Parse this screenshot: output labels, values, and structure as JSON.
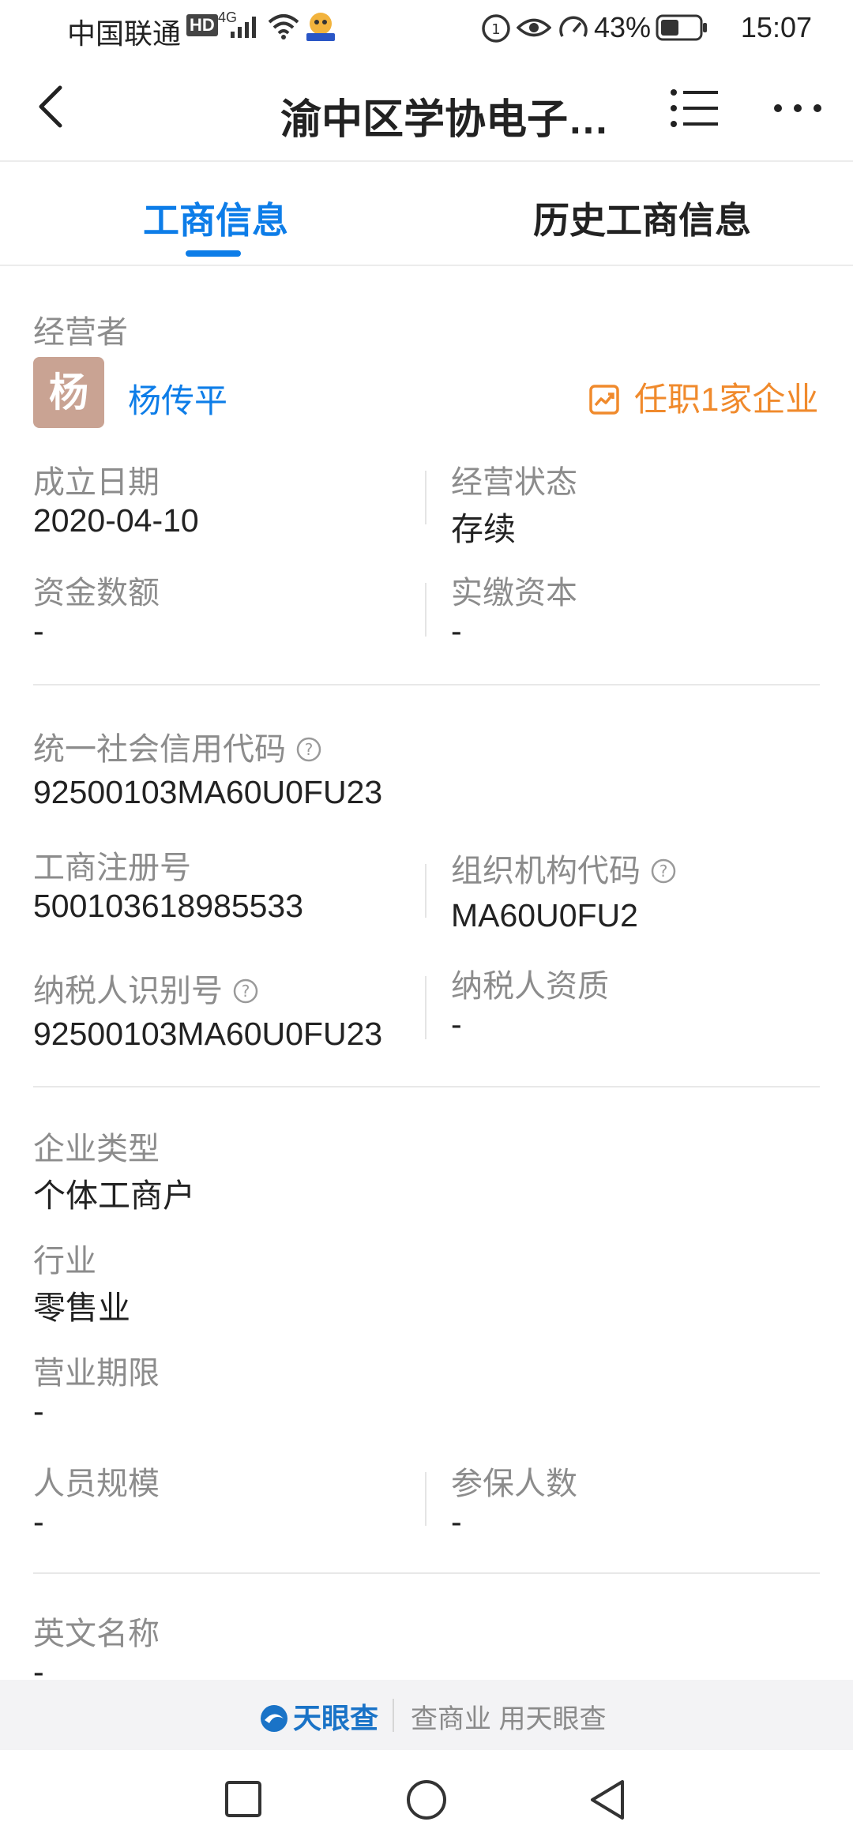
{
  "status_bar": {
    "carrier": "中国联通",
    "net_badge": "HD",
    "net_gen": "4G",
    "battery_percent": "43%",
    "time": "15:07"
  },
  "nav": {
    "title": "渝中区学协电子…"
  },
  "tabs": [
    {
      "label": "工商信息",
      "active": true
    },
    {
      "label": "历史工商信息",
      "active": false
    }
  ],
  "operator": {
    "label": "经营者",
    "avatar_char": "杨",
    "name": "杨传平",
    "jobs": "任职1家企业"
  },
  "info": {
    "established_label": "成立日期",
    "established_value": "2020-04-10",
    "status_label": "经营状态",
    "status_value": "存续",
    "capital_label": "资金数额",
    "capital_value": "-",
    "paid_label": "实缴资本",
    "paid_value": "-",
    "credit_label": "统一社会信用代码",
    "credit_value": "92500103MA60U0FU23",
    "reg_label": "工商注册号",
    "reg_value": "500103618985533",
    "org_label": "组织机构代码",
    "org_value": "MA60U0FU2",
    "taxid_label": "纳税人识别号",
    "taxid_value": "92500103MA60U0FU23",
    "taxqual_label": "纳税人资质",
    "taxqual_value": "-",
    "type_label": "企业类型",
    "type_value": "个体工商户",
    "industry_label": "行业",
    "industry_value": "零售业",
    "term_label": "营业期限",
    "term_value": "-",
    "staff_label": "人员规模",
    "staff_value": "-",
    "insured_label": "参保人数",
    "insured_value": "-",
    "english_label": "英文名称",
    "english_value": "-"
  },
  "footer": {
    "brand": "天眼查",
    "slogan": "查商业 用天眼查"
  },
  "colors": {
    "accent": "#0d7de8",
    "orange": "#f08a2c",
    "avatar": "#c9a393"
  }
}
